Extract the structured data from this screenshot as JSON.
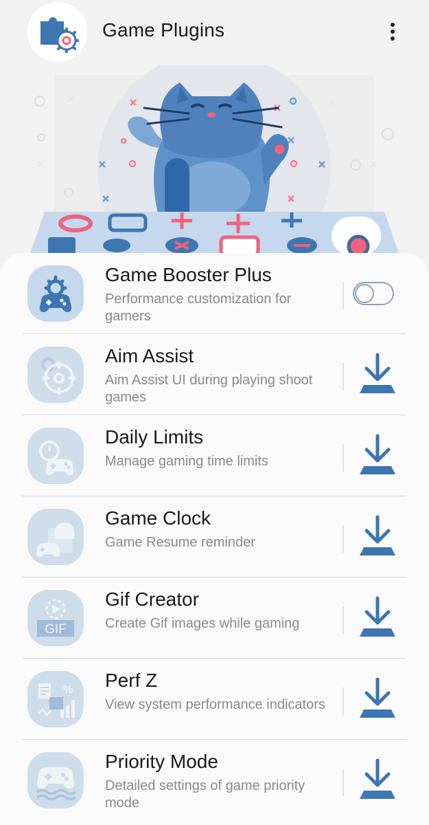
{
  "header": {
    "title": "Game Plugins",
    "app_icon": "puzzle-gear-icon",
    "more_icon": "more-vertical-icon"
  },
  "banner": {
    "illustration": "cat-with-game-controller-buttons"
  },
  "plugins": [
    {
      "name": "Game Booster Plus",
      "description": "Performance customization for gamers",
      "icon": "gamepad-gear-icon",
      "action": "toggle",
      "enabled": false
    },
    {
      "name": "Aim Assist",
      "description": "Aim Assist UI during playing shoot games",
      "icon": "crosshair-icon",
      "action": "download"
    },
    {
      "name": "Daily Limits",
      "description": "Manage gaming time limits",
      "icon": "timer-gamepad-icon",
      "action": "download"
    },
    {
      "name": "Game Clock",
      "description": "Game Resume reminder",
      "icon": "bell-gamepad-icon",
      "action": "download"
    },
    {
      "name": "Gif Creator",
      "description": "Create Gif images while gaming",
      "icon": "gif-play-icon",
      "action": "download",
      "icon_text": "GIF"
    },
    {
      "name": "Perf Z",
      "description": "View system performance indicators",
      "icon": "performance-chart-icon",
      "action": "download",
      "icon_text": "%"
    },
    {
      "name": "Priority Mode",
      "description": "Detailed settings of game priority mode",
      "icon": "gamepad-waves-icon",
      "action": "download"
    }
  ],
  "colors": {
    "accent": "#3d76b1",
    "icon_bg": "#c6d8ec",
    "pink": "#f0627d",
    "background": "#f2f2f2",
    "card": "#fafafa"
  }
}
